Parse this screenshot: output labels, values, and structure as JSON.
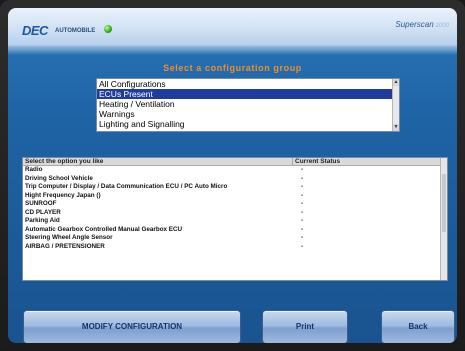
{
  "header": {
    "logo_text": "DEC",
    "logo_sub": "AUTOMOBILE",
    "brand": "Superscan",
    "brand_year": "2000"
  },
  "group_title": "Select a configuration group",
  "groups": [
    {
      "label": "All Configurations",
      "selected": false
    },
    {
      "label": "ECUs Present",
      "selected": true
    },
    {
      "label": "Heating / Ventilation",
      "selected": false
    },
    {
      "label": "Warnings",
      "selected": false
    },
    {
      "label": "Lighting and Signalling",
      "selected": false
    }
  ],
  "options_table": {
    "columns": [
      "Select the option you like",
      "Current Status"
    ],
    "rows": [
      {
        "option": "Radio",
        "status": "-"
      },
      {
        "option": "Driving School Vehicle",
        "status": "-"
      },
      {
        "option": "Trip Computer / Display / Data Communication ECU / PC Auto Micro",
        "status": "-"
      },
      {
        "option": "Hight Frequency Japan ()",
        "status": "-"
      },
      {
        "option": "SUNROOF",
        "status": "-"
      },
      {
        "option": "CD PLAYER",
        "status": "-"
      },
      {
        "option": "Parking Aid",
        "status": "-"
      },
      {
        "option": "Automatic Gearbox Controlled Manual Gearbox ECU",
        "status": "-"
      },
      {
        "option": "Steering Wheel Angle Sensor",
        "status": "-"
      },
      {
        "option": "AIRBAG / PRETENSIONER",
        "status": "-"
      }
    ]
  },
  "buttons": {
    "modify": "MODIFY CONFIGURATION",
    "print": "Print",
    "back": "Back"
  },
  "colors": {
    "title_orange": "#f28c28",
    "screen_blue": "#1f64a6",
    "selected_row": "#1f3c9c",
    "status_led": "#2faa18"
  }
}
